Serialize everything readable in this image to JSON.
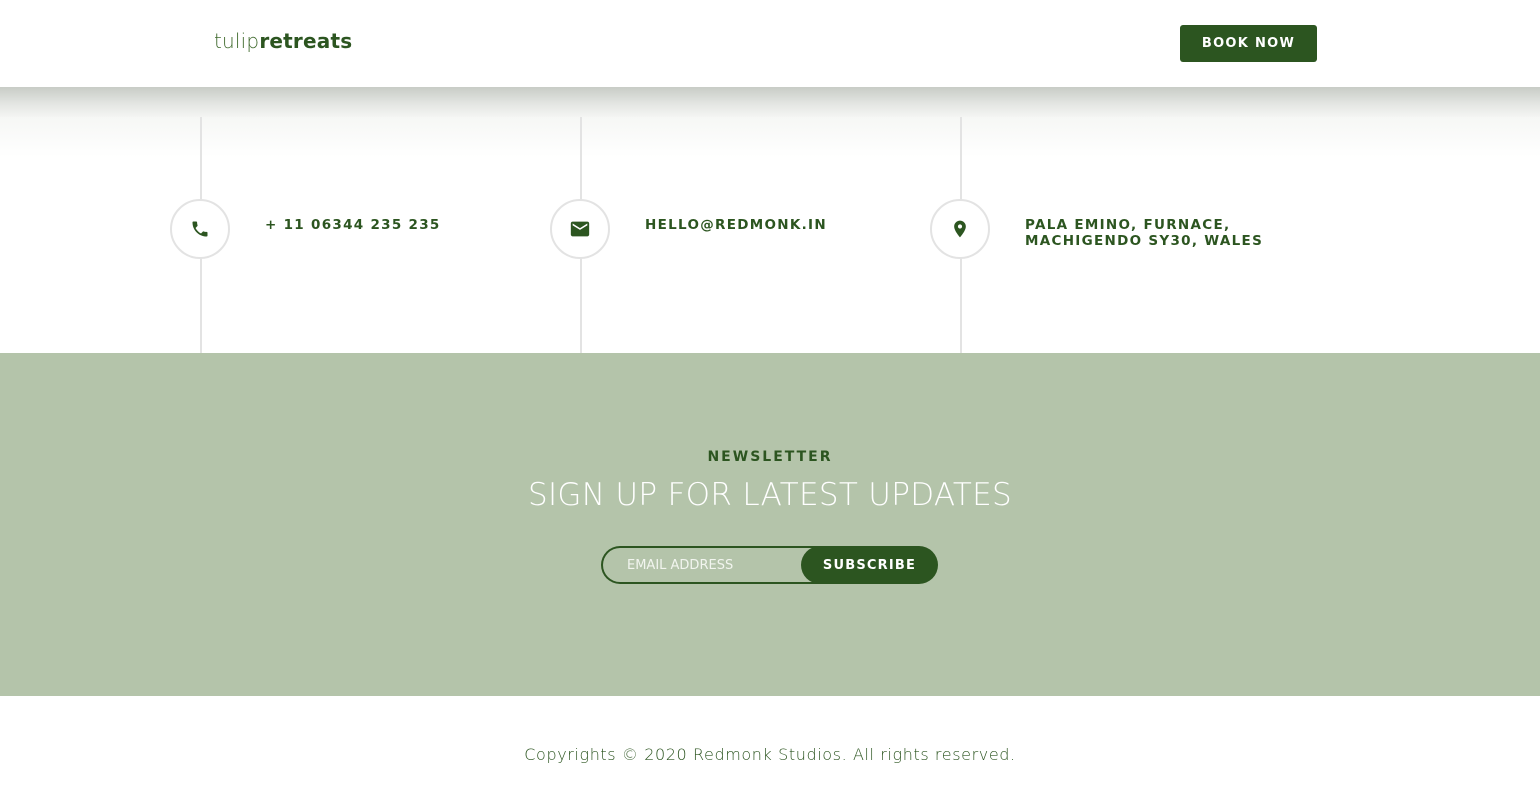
{
  "header": {
    "logo_light": "tulip",
    "logo_bold": "retreats",
    "book_button_label": "BOOK NOW"
  },
  "contact": {
    "items": [
      {
        "icon": "phone-icon",
        "lines": [
          "+ 11 06344 235 235"
        ]
      },
      {
        "icon": "mail-icon",
        "lines": [
          "HELLO@REDMONK.IN"
        ]
      },
      {
        "icon": "location-pin-icon",
        "lines": [
          "PALA EMINO, FURNACE,",
          "MACHIGENDO SY30, WALES"
        ]
      }
    ]
  },
  "newsletter": {
    "label": "NEWSLETTER",
    "heading": "SIGN UP FOR LATEST UPDATES",
    "email_placeholder": "EMAIL ADDRESS",
    "email_value": "",
    "subscribe_label": "SUBSCRIBE"
  },
  "footer": {
    "copyright": "Copyrights © 2020 Redmonk Studios. All rights reserved."
  },
  "colors": {
    "brand_green": "#2c5520",
    "newsletter_bg": "#b4c4aa",
    "divider": "#e3e3e3"
  }
}
